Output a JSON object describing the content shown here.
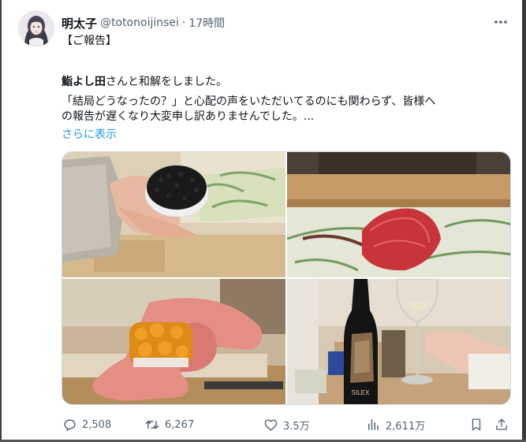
{
  "user": {
    "display_name": "明太子",
    "handle": "@totonoijinsei",
    "separator": "·",
    "time": "17時間"
  },
  "tweet": {
    "line1": "【ご報告】",
    "line2_bold": "鮨よし田",
    "line2_rest": "さんと和解をしました。",
    "line3": "「結局どうなったの？」と心配の声をいただいてるのにも関わらず、皆様へ",
    "line4": "の報告が遅くなり大変申し訳ありませんでした。...",
    "show_more": "さらに表示"
  },
  "media": {
    "count": 4,
    "photos": [
      "caviar-sushi-photo",
      "tuna-sushi-photo",
      "uni-sushi-photo",
      "wine-bottle-photo"
    ],
    "bottle_label": "SILEX"
  },
  "actions": {
    "reply_count": "2,508",
    "retweet_count": "6,267",
    "like_count": "3.5万",
    "view_count": "2,611万"
  },
  "icons": {
    "more": "more-icon",
    "reply": "reply-icon",
    "retweet": "retweet-icon",
    "like": "heart-icon",
    "views": "views-icon",
    "bookmark": "bookmark-icon",
    "share": "share-icon"
  },
  "colors": {
    "text_primary": "#0f1419",
    "text_secondary": "#536471",
    "link": "#1d9bf0",
    "border": "#cfd9de"
  }
}
